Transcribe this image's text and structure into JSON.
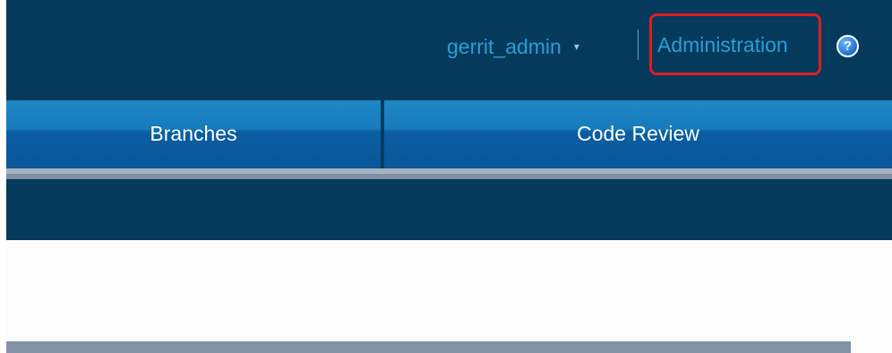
{
  "header": {
    "user_name": "gerrit_admin",
    "user_menu_caret": "▾",
    "admin_link": "Administration",
    "help_icon_glyph": "?",
    "help_icon": "help-question-circle-icon",
    "highlight_color": "#e11c22",
    "link_color": "#2a9fd6",
    "background_color": "#053a5c"
  },
  "tabs": [
    {
      "label": "Branches"
    },
    {
      "label": "Code Review"
    }
  ]
}
